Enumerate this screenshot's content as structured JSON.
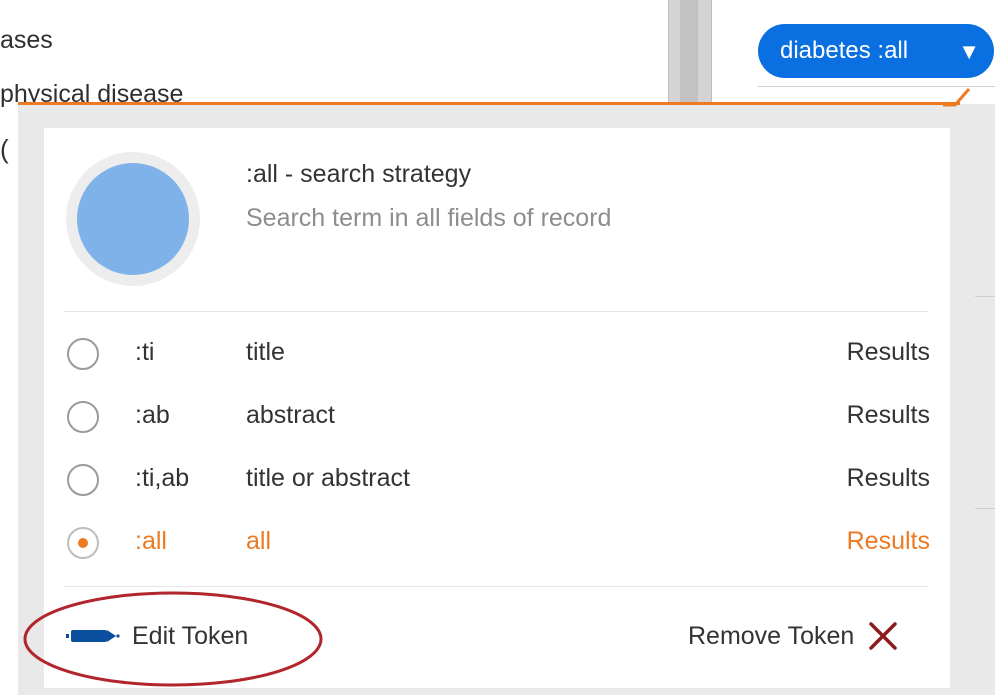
{
  "background": {
    "line1": "ases",
    "line2": "physical disease",
    "line3": "("
  },
  "token": {
    "label": "diabetes :all",
    "caret": "▼"
  },
  "popup": {
    "title": ":all - search strategy",
    "description": "Search term in all fields of record",
    "options": [
      {
        "code": ":ti",
        "label": "title",
        "results": "Results",
        "selected": false
      },
      {
        "code": ":ab",
        "label": "abstract",
        "results": "Results",
        "selected": false
      },
      {
        "code": ":ti,ab",
        "label": "title or abstract",
        "results": "Results",
        "selected": false
      },
      {
        "code": ":all",
        "label": "all",
        "results": "Results",
        "selected": true
      }
    ],
    "edit_token_label": "Edit Token",
    "remove_token_label": "Remove Token"
  },
  "colors": {
    "accent": "#ec7a22",
    "token_blue": "#0a6fe0",
    "avatar": "#7eb2e8",
    "remove_x": "#8b1a1a",
    "highlight_ellipse": "#b0262c"
  }
}
